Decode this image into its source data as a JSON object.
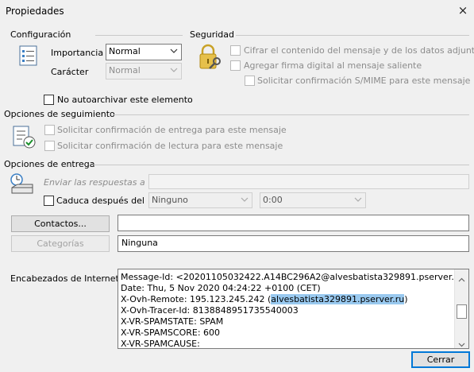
{
  "window": {
    "title": "Propiedades",
    "close_glyph": "×"
  },
  "configuracion": {
    "title": "Configuración",
    "importancia_label": "Importancia",
    "importancia_value": "Normal",
    "caracter_label": "Carácter",
    "caracter_value": "Normal",
    "no_autoarchivar": "No autoarchivar este elemento",
    "icon": "document-settings-icon"
  },
  "seguridad": {
    "title": "Seguridad",
    "cifrar": "Cifrar el contenido del mensaje y de los datos adjuntos",
    "firma": "Agregar firma digital al mensaje saliente",
    "smime": "Solicitar confirmación S/MIME para este mensaje",
    "icon": "lock-key-icon"
  },
  "seguimiento": {
    "title": "Opciones de seguimiento",
    "entrega": "Solicitar confirmación de entrega para este mensaje",
    "lectura": "Solicitar confirmación de lectura para este mensaje",
    "icon": "checklist-icon"
  },
  "entrega": {
    "title": "Opciones de entrega",
    "enviar_respuestas": "Enviar las respuestas a",
    "caduca": "Caduca después del",
    "fecha_value": "Ninguno",
    "hora_value": "0:00",
    "icon": "clock-tray-icon"
  },
  "contactos": {
    "button": "Contactos...",
    "value": ""
  },
  "categorias": {
    "button": "Categorías",
    "value": "Ninguna"
  },
  "encabezados": {
    "label": "Encabezados de Internet",
    "lines": [
      "Message-Id: <20201105032422.A14BC296A2@alvesbatista329891.pserver.ru>",
      "Date: Thu,  5 Nov 2020 04:24:22 +0100 (CET)",
      "X-Ovh-Tracer-Id: 8138848951735540003",
      "X-VR-SPAMSTATE: SPAM",
      "X-VR-SPAMSCORE: 600",
      "X-VR-SPAMCAUSE:"
    ],
    "remote_prefix": "X-Ovh-Remote: 195.123.245.242 (",
    "remote_highlight": "alvesbatista329891.pserver.ru",
    "remote_suffix": ")"
  },
  "cerrar_button": "Cerrar"
}
